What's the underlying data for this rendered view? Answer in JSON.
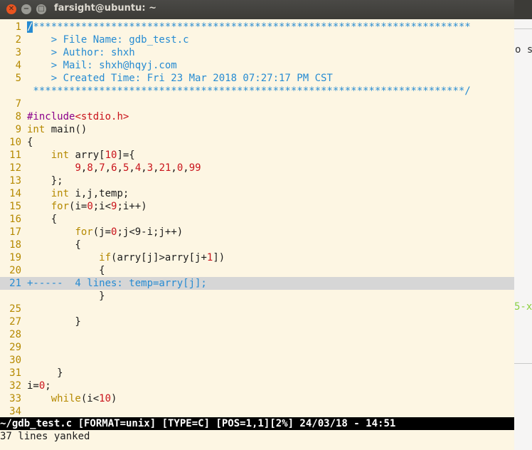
{
  "window": {
    "title": "farsight@ubuntu: ~"
  },
  "background_window": {
    "text_top": "o s",
    "text_green": "5-x"
  },
  "editor": {
    "lines": [
      {
        "n": "1",
        "segs": [
          [
            "cur",
            "/"
          ],
          [
            "cm",
            "*************************************************************************"
          ]
        ]
      },
      {
        "n": "2",
        "segs": [
          [
            "cm",
            "    > File Name: gdb_test.c"
          ]
        ]
      },
      {
        "n": "3",
        "segs": [
          [
            "cm",
            "    > Author: shxh"
          ]
        ]
      },
      {
        "n": "4",
        "segs": [
          [
            "cm",
            "    > Mail: shxh@hqyj.com"
          ]
        ]
      },
      {
        "n": "5",
        "segs": [
          [
            "cm",
            "    > Created Time: Fri 23 Mar 2018 07:27:17 PM CST"
          ]
        ]
      },
      {
        "n": "",
        "segs": [
          [
            "cm",
            " ************************************************************************/"
          ]
        ]
      },
      {
        "n": "7",
        "segs": [
          [
            "",
            ""
          ]
        ]
      },
      {
        "n": "8",
        "segs": [
          [
            "pp",
            "#include"
          ],
          [
            "inc",
            "<stdio.h>"
          ]
        ]
      },
      {
        "n": "9",
        "segs": [
          [
            "kw",
            "int"
          ],
          [
            "",
            " main()"
          ]
        ]
      },
      {
        "n": "10",
        "segs": [
          [
            "",
            "{"
          ]
        ]
      },
      {
        "n": "11",
        "segs": [
          [
            "",
            "    "
          ],
          [
            "kw",
            "int"
          ],
          [
            "",
            " arry["
          ],
          [
            "num",
            "10"
          ],
          [
            "",
            "]={"
          ]
        ]
      },
      {
        "n": "12",
        "segs": [
          [
            "",
            "        "
          ],
          [
            "num",
            "9"
          ],
          [
            "",
            ","
          ],
          [
            "num",
            "8"
          ],
          [
            "",
            ","
          ],
          [
            "num",
            "7"
          ],
          [
            "",
            ","
          ],
          [
            "num",
            "6"
          ],
          [
            "",
            ","
          ],
          [
            "num",
            "5"
          ],
          [
            "",
            ","
          ],
          [
            "num",
            "4"
          ],
          [
            "",
            ","
          ],
          [
            "num",
            "3"
          ],
          [
            "",
            ","
          ],
          [
            "num",
            "21"
          ],
          [
            "",
            ","
          ],
          [
            "num",
            "0"
          ],
          [
            "",
            ","
          ],
          [
            "num",
            "99"
          ]
        ]
      },
      {
        "n": "13",
        "segs": [
          [
            "",
            "    };"
          ]
        ]
      },
      {
        "n": "14",
        "segs": [
          [
            "",
            "    "
          ],
          [
            "kw",
            "int"
          ],
          [
            "",
            " i,j,temp;"
          ]
        ]
      },
      {
        "n": "15",
        "segs": [
          [
            "",
            "    "
          ],
          [
            "kw",
            "for"
          ],
          [
            "",
            "(i="
          ],
          [
            "num",
            "0"
          ],
          [
            "",
            ";i<"
          ],
          [
            "num",
            "9"
          ],
          [
            "",
            ";i++)"
          ]
        ]
      },
      {
        "n": "16",
        "segs": [
          [
            "",
            "    {"
          ]
        ]
      },
      {
        "n": "17",
        "segs": [
          [
            "",
            "        "
          ],
          [
            "kw",
            "for"
          ],
          [
            "",
            "(j="
          ],
          [
            "num",
            "0"
          ],
          [
            "",
            ";j<9-i;j++)"
          ]
        ]
      },
      {
        "n": "18",
        "segs": [
          [
            "",
            "        {"
          ]
        ]
      },
      {
        "n": "19",
        "segs": [
          [
            "",
            "            "
          ],
          [
            "kw",
            "if"
          ],
          [
            "",
            "(arry[j]>arry[j+"
          ],
          [
            "num",
            "1"
          ],
          [
            "",
            "])"
          ]
        ]
      },
      {
        "n": "20",
        "segs": [
          [
            "",
            "            {"
          ]
        ]
      },
      {
        "n": "21",
        "fold": true,
        "segs": [
          [
            "",
            "+-----  4 lines: temp=arry[j];"
          ]
        ]
      },
      {
        "n": "",
        "segs": [
          [
            "",
            "            }"
          ]
        ]
      },
      {
        "n": "25",
        "segs": [
          [
            "",
            ""
          ]
        ]
      },
      {
        "n": "27",
        "segs": [
          [
            "",
            "        }"
          ]
        ]
      },
      {
        "n": "28",
        "segs": [
          [
            "",
            ""
          ]
        ]
      },
      {
        "n": "29",
        "segs": [
          [
            "",
            ""
          ]
        ]
      },
      {
        "n": "30",
        "segs": [
          [
            "",
            ""
          ]
        ]
      },
      {
        "n": "31",
        "segs": [
          [
            "",
            "     }"
          ]
        ]
      },
      {
        "n": "32",
        "segs": [
          [
            "",
            "i="
          ],
          [
            "num",
            "0"
          ],
          [
            "",
            ";"
          ]
        ]
      },
      {
        "n": "33",
        "segs": [
          [
            "",
            "    "
          ],
          [
            "kw",
            "while"
          ],
          [
            "",
            "(i<"
          ],
          [
            "num",
            "10"
          ],
          [
            "",
            ")"
          ]
        ]
      },
      {
        "n": "34",
        "segs": [
          [
            "",
            ""
          ]
        ]
      }
    ],
    "status_line": "~/gdb_test.c [FORMAT=unix] [TYPE=C] [POS=1,1][2%] 24/03/18 - 14:51",
    "command_line": "37 lines yanked"
  },
  "colors": {
    "background": "#fdf6e3",
    "line_number": "#b58900",
    "comment": "#268bd2",
    "number": "#c9131b",
    "fold_bg": "#d6d6d6"
  }
}
